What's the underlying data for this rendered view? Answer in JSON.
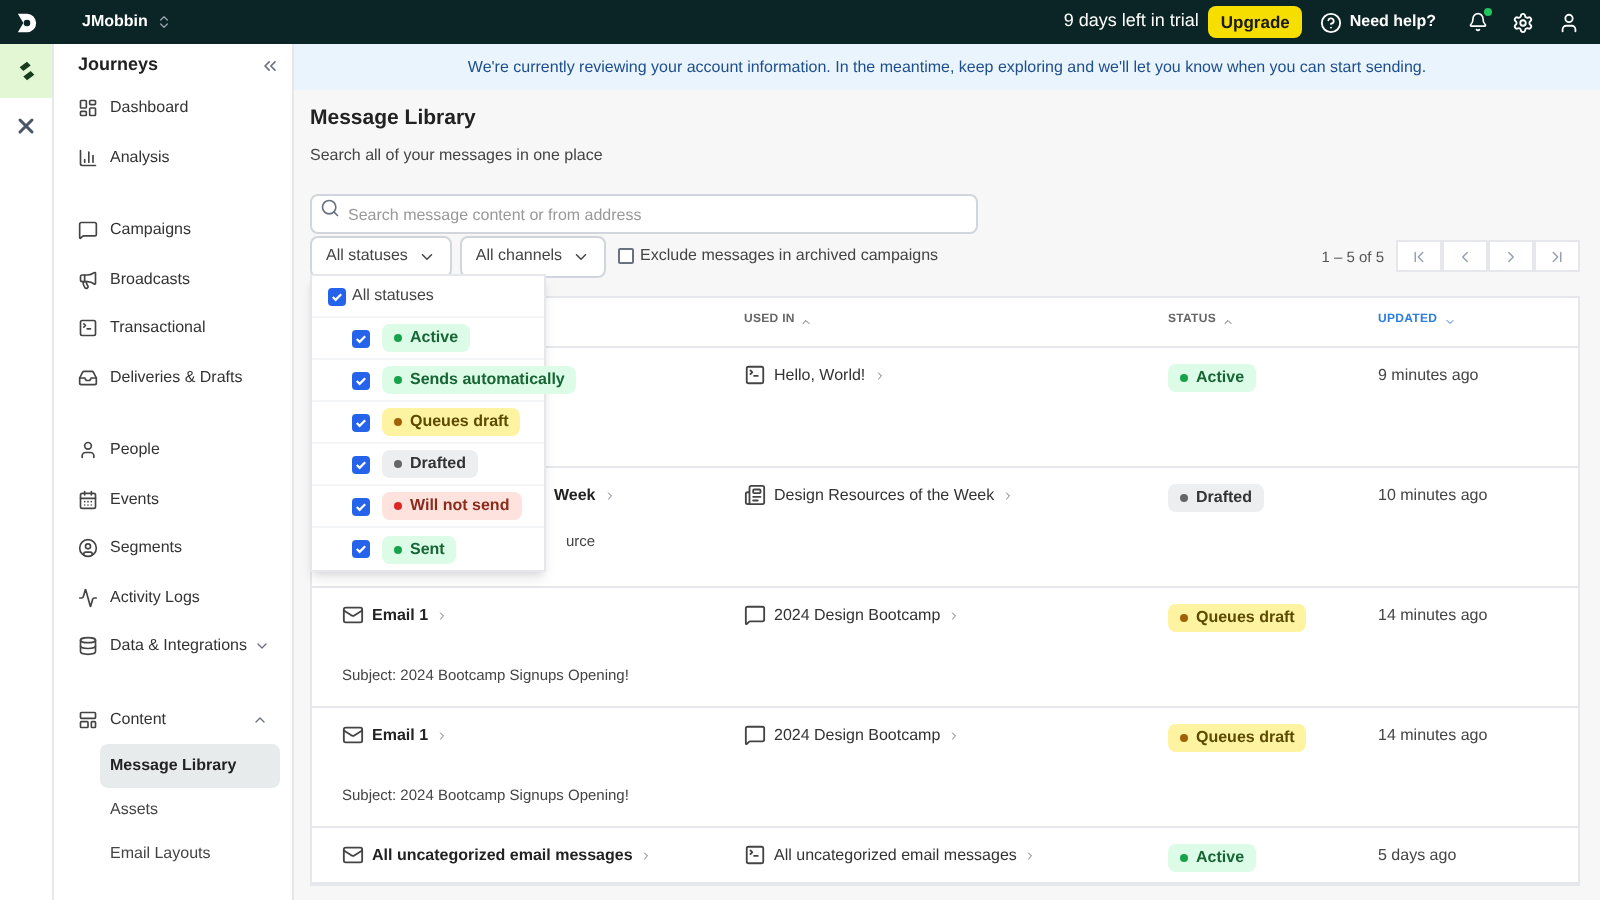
{
  "topbar": {
    "workspace": "JMobbin",
    "trial": "9 days left in trial",
    "upgrade": "Upgrade",
    "help": "Need help?",
    "notification_dot": true
  },
  "rail": [
    {
      "selected": true
    },
    {
      "selected": false
    }
  ],
  "sidebar": {
    "title": "Journeys",
    "groups": [
      [
        {
          "label": "Dashboard",
          "selected": false
        },
        {
          "label": "Analysis",
          "selected": false
        }
      ],
      [
        {
          "label": "Campaigns",
          "selected": false
        },
        {
          "label": "Broadcasts",
          "selected": false
        },
        {
          "label": "Transactional",
          "selected": false
        },
        {
          "label": "Deliveries & Drafts",
          "selected": false
        }
      ],
      [
        {
          "label": "People",
          "selected": false
        },
        {
          "label": "Events",
          "selected": false
        },
        {
          "label": "Segments",
          "selected": false
        },
        {
          "label": "Activity Logs",
          "selected": false
        },
        {
          "label": "Data & Integrations",
          "selected": false,
          "expanded": false
        }
      ],
      [
        {
          "label": "Content",
          "selected": false,
          "expanded": true,
          "children": [
            {
              "label": "Message Library",
              "selected": true
            },
            {
              "label": "Assets",
              "selected": false
            },
            {
              "label": "Email Layouts",
              "selected": false
            }
          ]
        }
      ]
    ]
  },
  "banner": "We're currently reviewing your account information. In the meantime, keep exploring and we'll let you know when you can start sending.",
  "page": {
    "title": "Message Library",
    "subtitle": "Search all of your messages in one place"
  },
  "search": {
    "placeholder": "Search message content or from address"
  },
  "filters": {
    "status": "All statuses",
    "channels": "All channels",
    "exclude_archived": {
      "label": "Exclude messages in archived campaigns",
      "checked": false
    }
  },
  "pagination": {
    "range": "1 – 5 of 5"
  },
  "status_menu": {
    "all": {
      "label": "All statuses",
      "checked": true
    },
    "items": [
      {
        "label": "Active",
        "kind": "active",
        "checked": true
      },
      {
        "label": "Sends automatically",
        "kind": "sent",
        "checked": true
      },
      {
        "label": "Queues draft",
        "kind": "queued",
        "checked": true
      },
      {
        "label": "Drafted",
        "kind": "drafted",
        "checked": true
      },
      {
        "label": "Will not send",
        "kind": "failed",
        "checked": true
      },
      {
        "label": "Sent",
        "kind": "sent",
        "checked": true
      }
    ]
  },
  "table": {
    "columns": [
      {
        "label": "USED IN",
        "sorted": false
      },
      {
        "label": "STATUS",
        "sorted": false
      },
      {
        "label": "UPDATED",
        "sorted": true
      }
    ],
    "rows": [
      {
        "used_in": "Hello, World!",
        "status": {
          "label": "Active",
          "kind": "active"
        },
        "updated": "9 minutes ago"
      },
      {
        "name": "Week",
        "subject": "urce",
        "used_in": "Design Resources of the Week",
        "status": {
          "label": "Drafted",
          "kind": "drafted"
        },
        "updated": "10 minutes ago"
      },
      {
        "name": "Email 1",
        "subject": "Subject: 2024 Bootcamp Signups Opening!",
        "used_in": "2024 Design Bootcamp",
        "status": {
          "label": "Queues draft",
          "kind": "queued"
        },
        "updated": "14 minutes ago"
      },
      {
        "name": "Email 1",
        "subject": "Subject: 2024 Bootcamp Signups Opening!",
        "used_in": "2024 Design Bootcamp",
        "status": {
          "label": "Queues draft",
          "kind": "queued"
        },
        "updated": "14 minutes ago"
      },
      {
        "name": "All uncategorized email messages",
        "used_in": "All uncategorized email messages",
        "status": {
          "label": "Active",
          "kind": "active"
        },
        "updated": "5 days ago"
      }
    ]
  }
}
